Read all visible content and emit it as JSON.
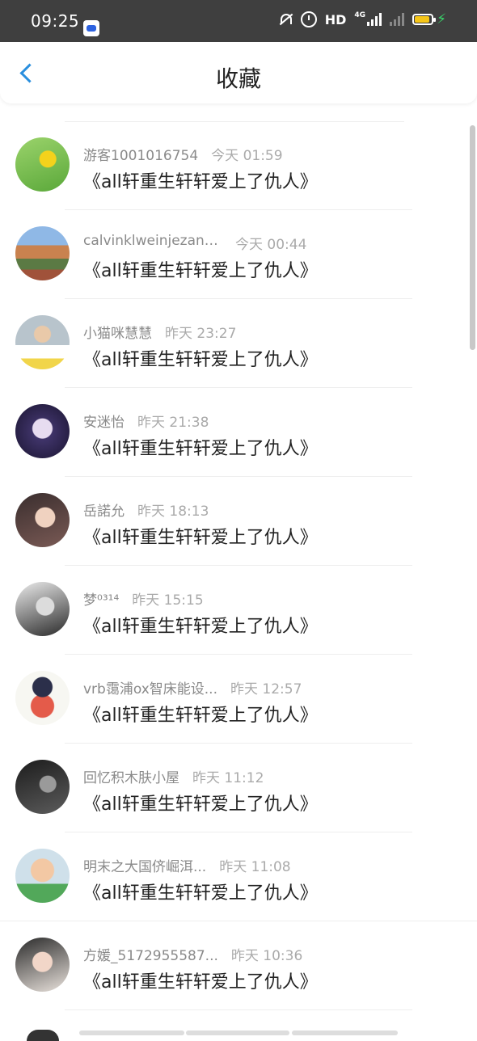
{
  "status_bar": {
    "time": "09:25",
    "hd": "HD",
    "network": "4G",
    "icons": [
      "bell-muted-icon",
      "alarm-icon",
      "signal-icon",
      "battery-charging-icon"
    ]
  },
  "header": {
    "title": "收藏",
    "back_icon": "chevron-left-icon"
  },
  "colors": {
    "accent": "#2a8fde",
    "status_bar_bg": "#3f3f3f",
    "battery_fill": "#f5c518",
    "charging": "#3ad36a"
  },
  "items": [
    {
      "name": "游客1001016754",
      "time": "今天 01:59",
      "title": "《all轩重生轩轩爱上了仇人》"
    },
    {
      "name": "calvinklweinjezans...",
      "time": "今天 00:44",
      "title": "《all轩重生轩轩爱上了仇人》"
    },
    {
      "name": "小猫咪慧慧",
      "time": "昨天 23:27",
      "title": "《all轩重生轩轩爱上了仇人》"
    },
    {
      "name": "安迷怡",
      "time": "昨天 21:38",
      "title": "《all轩重生轩轩爱上了仇人》"
    },
    {
      "name": "岳諾允",
      "time": "昨天 18:13",
      "title": "《all轩重生轩轩爱上了仇人》"
    },
    {
      "name": "梦⁰³¹⁴",
      "time": "昨天 15:15",
      "title": "《all轩重生轩轩爱上了仇人》"
    },
    {
      "name": "vrb霭浦ox智床能设...",
      "time": "昨天 12:57",
      "title": "《all轩重生轩轩爱上了仇人》"
    },
    {
      "name": "回忆积木肤小屋",
      "time": "昨天 11:12",
      "title": "《all轩重生轩轩爱上了仇人》"
    },
    {
      "name": "明末之大国侪崛洱...",
      "time": "昨天 11:08",
      "title": "《all轩重生轩轩爱上了仇人》"
    },
    {
      "name": "方媛_5172955587...",
      "time": "昨天 10:36",
      "title": "《all轩重生轩轩爱上了仇人》"
    }
  ]
}
